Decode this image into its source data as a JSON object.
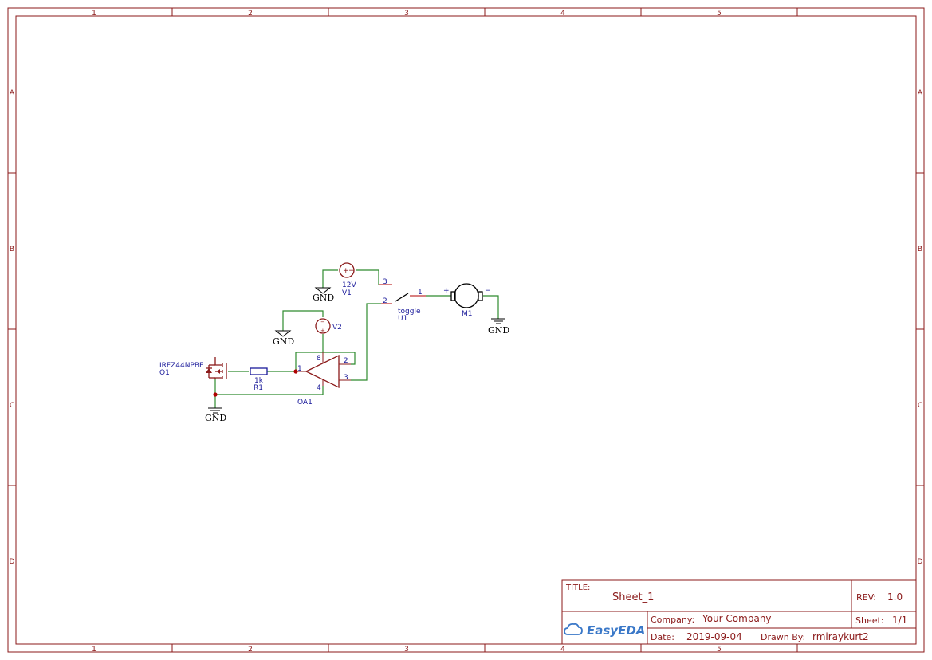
{
  "sheet": {
    "columns": [
      "1",
      "2",
      "3",
      "4",
      "5"
    ],
    "rows": [
      "A",
      "B",
      "C",
      "D"
    ]
  },
  "components": {
    "q1": {
      "part": "IRFZ44NPBF",
      "ref": "Q1"
    },
    "r1": {
      "value": "1k",
      "ref": "R1"
    },
    "v1": {
      "value": "12V",
      "ref": "V1"
    },
    "v2": {
      "ref": "V2"
    },
    "u1": {
      "value": "toggle",
      "ref": "U1",
      "pins": [
        "3",
        "2",
        "1"
      ]
    },
    "m1": {
      "ref": "M1",
      "plus": "+",
      "minus": "−"
    },
    "oa1": {
      "ref": "OA1",
      "pins": [
        "1",
        "2",
        "3",
        "8",
        "4"
      ]
    },
    "gnd_label": "GND"
  },
  "title_block": {
    "title_label": "TITLE:",
    "title": "Sheet_1",
    "rev_label": "REV:",
    "rev": "1.0",
    "logo": "EasyEDA",
    "company_label": "Company:",
    "company": "Your Company",
    "sheet_label": "Sheet:",
    "sheet": "1/1",
    "date_label": "Date:",
    "date": "2019-09-04",
    "drawn_label": "Drawn By:",
    "drawn_by": "rmiraykurt2"
  }
}
